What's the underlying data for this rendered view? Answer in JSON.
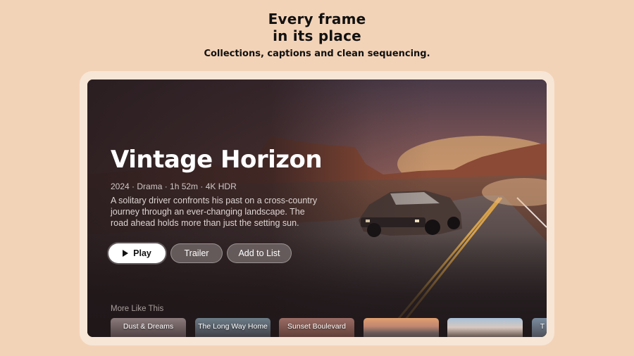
{
  "promo": {
    "title_line1": "Every frame",
    "title_line2": "in its place",
    "subtitle": "Collections, captions and clean sequencing."
  },
  "featured": {
    "title": "Vintage Horizon",
    "meta": "2024 · Drama · 1h 52m · 4K HDR",
    "description": "A solitary driver confronts his past on a cross-country journey through an ever-changing landscape. The road ahead holds more than just the setting sun."
  },
  "actions": {
    "play_label": "Play",
    "trailer_label": "Trailer",
    "add_label": "Add to List"
  },
  "more": {
    "label": "More Like This",
    "items": [
      {
        "title": "Dust & Dreams"
      },
      {
        "title": "The Long Way Home"
      },
      {
        "title": "Sunset Boulevard"
      },
      {
        "title": ""
      },
      {
        "title": ""
      },
      {
        "title": "T"
      }
    ]
  },
  "colors": {
    "background": "#f3d3b8",
    "frame": "#f7e6d6",
    "accent": "#ffffff"
  }
}
